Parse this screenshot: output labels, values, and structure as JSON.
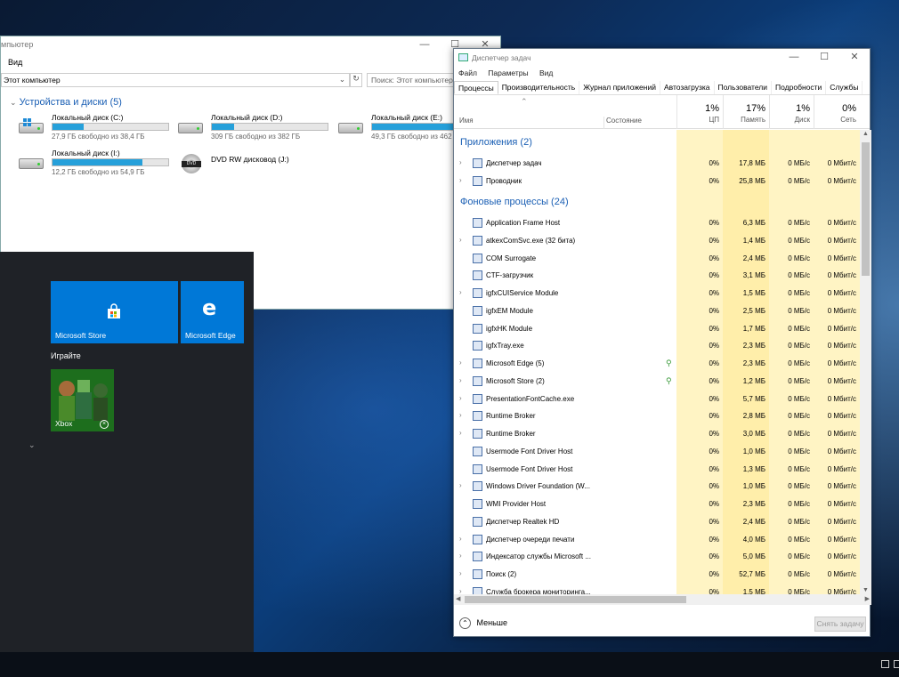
{
  "explorer": {
    "title": "мпьютер",
    "menu_view": "Вид",
    "address": "Этот компьютер",
    "search_placeholder": "Поиск: Этот компьютер",
    "group_title": "Устройства и диски (5)",
    "drives": [
      {
        "name": "Локальный диск (C:)",
        "free": "27,9 ГБ свободно из 38,4 ГБ",
        "used_fraction": 0.27,
        "icon": "windows-drive-icon"
      },
      {
        "name": "Локальный диск (D:)",
        "free": "309 ГБ свободно из 382 ГБ",
        "used_fraction": 0.19,
        "icon": "hard-drive-icon"
      },
      {
        "name": "Локальный диск (E:)",
        "free": "49,3 ГБ свободно из 462",
        "used_fraction": 0.89,
        "icon": "hard-drive-icon"
      },
      {
        "name": "Локальный диск (I:)",
        "free": "12,2 ГБ свободно из 54,9 ГБ",
        "used_fraction": 0.78,
        "icon": "hard-drive-icon"
      },
      {
        "name": "DVD RW дисковод (J:)",
        "free": "",
        "icon": "dvd-drive-icon",
        "dvd_label": "DVD"
      }
    ]
  },
  "start": {
    "tiles": [
      {
        "label": "Microsoft Store",
        "icon": "store-bag-icon",
        "color": "#0078d7"
      },
      {
        "label": "Microsoft Edge",
        "icon": "edge-e-icon",
        "color": "#0078d7"
      },
      {
        "label": "Xbox",
        "icon": "xbox-icon",
        "color": "#107c10"
      }
    ],
    "section_play": "Играйте"
  },
  "taskmanager": {
    "title": "Диспетчер задач",
    "menu": [
      "Файл",
      "Параметры",
      "Вид"
    ],
    "tabs": [
      "Процессы",
      "Производительность",
      "Журнал приложений",
      "Автозагрузка",
      "Пользователи",
      "Подробности",
      "Службы"
    ],
    "headers": {
      "name": "Имя",
      "status": "Состояние",
      "cpu_pct": "1%",
      "cpu": "ЦП",
      "mem_pct": "17%",
      "mem": "Память",
      "disk_pct": "1%",
      "disk": "Диск",
      "net_pct": "0%",
      "net": "Сеть"
    },
    "groups": {
      "apps": "Приложения (2)",
      "background": "Фоновые процессы (24)"
    },
    "apps": [
      {
        "name": "Диспетчер задач",
        "cpu": "0%",
        "mem": "17,8 МБ",
        "disk": "0 МБ/с",
        "net": "0 Мбит/с",
        "expand": true
      },
      {
        "name": "Проводник",
        "cpu": "0%",
        "mem": "25,8 МБ",
        "disk": "0 МБ/с",
        "net": "0 Мбит/с",
        "expand": true
      }
    ],
    "background": [
      {
        "name": "Application Frame Host",
        "cpu": "0%",
        "mem": "6,3 МБ",
        "disk": "0 МБ/с",
        "net": "0 Мбит/с",
        "expand": false
      },
      {
        "name": "atkexComSvc.exe (32 бита)",
        "cpu": "0%",
        "mem": "1,4 МБ",
        "disk": "0 МБ/с",
        "net": "0 Мбит/с",
        "expand": true
      },
      {
        "name": "COM Surrogate",
        "cpu": "0%",
        "mem": "2,4 МБ",
        "disk": "0 МБ/с",
        "net": "0 Мбит/с",
        "expand": false
      },
      {
        "name": "CTF-загрузчик",
        "cpu": "0%",
        "mem": "3,1 МБ",
        "disk": "0 МБ/с",
        "net": "0 Мбит/с",
        "expand": false
      },
      {
        "name": "igfxCUIService Module",
        "cpu": "0%",
        "mem": "1,5 МБ",
        "disk": "0 МБ/с",
        "net": "0 Мбит/с",
        "expand": true
      },
      {
        "name": "igfxEM Module",
        "cpu": "0%",
        "mem": "2,5 МБ",
        "disk": "0 МБ/с",
        "net": "0 Мбит/с",
        "expand": false
      },
      {
        "name": "igfxHK Module",
        "cpu": "0%",
        "mem": "1,7 МБ",
        "disk": "0 МБ/с",
        "net": "0 Мбит/с",
        "expand": false
      },
      {
        "name": "igfxTray.exe",
        "cpu": "0%",
        "mem": "2,3 МБ",
        "disk": "0 МБ/с",
        "net": "0 Мбит/с",
        "expand": false
      },
      {
        "name": "Microsoft Edge (5)",
        "cpu": "0%",
        "mem": "2,3 МБ",
        "disk": "0 МБ/с",
        "net": "0 Мбит/с",
        "expand": true,
        "leaf": true
      },
      {
        "name": "Microsoft Store (2)",
        "cpu": "0%",
        "mem": "1,2 МБ",
        "disk": "0 МБ/с",
        "net": "0 Мбит/с",
        "expand": true,
        "leaf": true
      },
      {
        "name": "PresentationFontCache.exe",
        "cpu": "0%",
        "mem": "5,7 МБ",
        "disk": "0 МБ/с",
        "net": "0 Мбит/с",
        "expand": true
      },
      {
        "name": "Runtime Broker",
        "cpu": "0%",
        "mem": "2,8 МБ",
        "disk": "0 МБ/с",
        "net": "0 Мбит/с",
        "expand": true
      },
      {
        "name": "Runtime Broker",
        "cpu": "0%",
        "mem": "3,0 МБ",
        "disk": "0 МБ/с",
        "net": "0 Мбит/с",
        "expand": true
      },
      {
        "name": "Usermode Font Driver Host",
        "cpu": "0%",
        "mem": "1,0 МБ",
        "disk": "0 МБ/с",
        "net": "0 Мбит/с",
        "expand": false
      },
      {
        "name": "Usermode Font Driver Host",
        "cpu": "0%",
        "mem": "1,3 МБ",
        "disk": "0 МБ/с",
        "net": "0 Мбит/с",
        "expand": false
      },
      {
        "name": "Windows Driver Foundation (W...",
        "cpu": "0%",
        "mem": "1,0 МБ",
        "disk": "0 МБ/с",
        "net": "0 Мбит/с",
        "expand": true
      },
      {
        "name": "WMI Provider Host",
        "cpu": "0%",
        "mem": "2,3 МБ",
        "disk": "0 МБ/с",
        "net": "0 Мбит/с",
        "expand": false
      },
      {
        "name": "Диспетчер Realtek HD",
        "cpu": "0%",
        "mem": "2,4 МБ",
        "disk": "0 МБ/с",
        "net": "0 Мбит/с",
        "expand": false
      },
      {
        "name": "Диспетчер очереди печати",
        "cpu": "0%",
        "mem": "4,0 МБ",
        "disk": "0 МБ/с",
        "net": "0 Мбит/с",
        "expand": true
      },
      {
        "name": "Индексатор службы Microsoft ...",
        "cpu": "0%",
        "mem": "5,0 МБ",
        "disk": "0 МБ/с",
        "net": "0 Мбит/с",
        "expand": true
      },
      {
        "name": "Поиск (2)",
        "cpu": "0%",
        "mem": "52,7 МБ",
        "disk": "0 МБ/с",
        "net": "0 Мбит/с",
        "expand": true
      },
      {
        "name": "Служба брокера мониторинга...",
        "cpu": "0%",
        "mem": "1,5 МБ",
        "disk": "0 МБ/с",
        "net": "0 Мбит/с",
        "expand": true
      }
    ],
    "less_label": "Меньше",
    "end_task_label": "Снять задачу"
  }
}
